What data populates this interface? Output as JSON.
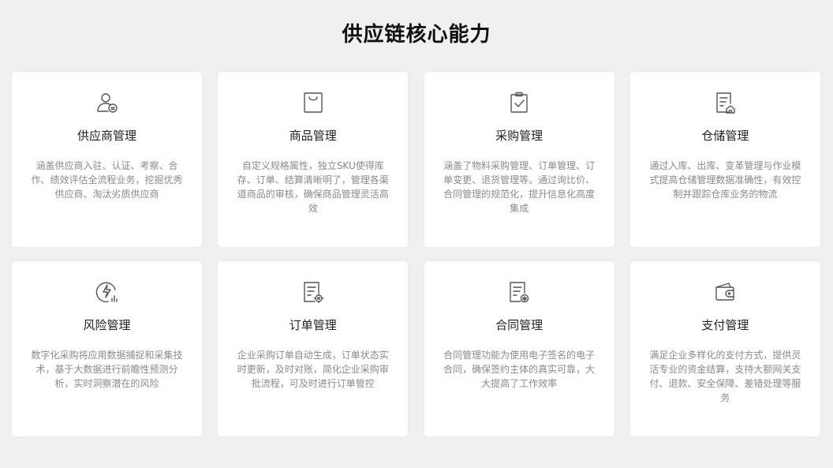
{
  "page": {
    "title": "供应链核心能力"
  },
  "cards": [
    {
      "icon": "supplier-user-icon",
      "title": "供应商管理",
      "desc": "涵盖供应商入驻、认证、考察、合作、绩效评估全流程业务，挖掘优秀供应商、淘汰劣质供应商"
    },
    {
      "icon": "shopping-bag-icon",
      "title": "商品管理",
      "desc": "自定义规格属性，独立SKU使得库存、订单、结算清晰明了，管理各渠道商品的审核，确保商品管理灵活高效"
    },
    {
      "icon": "clipboard-check-icon",
      "title": "采购管理",
      "desc": "涵盖了物料采购管理、订单管理、订单变更、退货管理等。通过询比价、合同管理的规范化，提升信息化高度集成"
    },
    {
      "icon": "warehouse-document-icon",
      "title": "仓储管理",
      "desc": "通过入库、出库、变革管理与作业模式提高仓储管理数据准确性，有效控制并跟踪仓库业务的物流"
    },
    {
      "icon": "risk-lightning-icon",
      "title": "风险管理",
      "desc": "数字化采购将应用数据捕捉和采集技术，基于大数据进行前瞻性预测分析，实时洞察潜在的风险"
    },
    {
      "icon": "order-settings-icon",
      "title": "订单管理",
      "desc": "企业采购订单自动生成，订单状态实时更新，及时对账，简化企业采购审批流程，可及时进行订单管控"
    },
    {
      "icon": "contract-document-icon",
      "title": "合同管理",
      "desc": "合同管理功能为使用电子签名的电子合同，确保签约主体的真实可靠，大大提高了工作效率"
    },
    {
      "icon": "wallet-icon",
      "title": "支付管理",
      "desc": "满足企业多样化的支付方式，提供灵活专业的资金结算，支持大额网关支付、退款、安全保障、差错处理等服务"
    }
  ]
}
